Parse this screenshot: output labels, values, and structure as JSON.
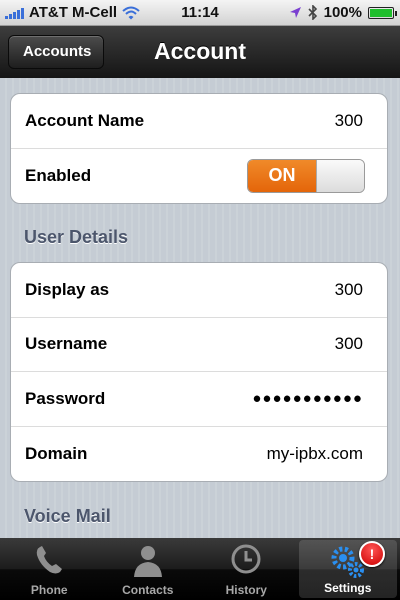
{
  "status_bar": {
    "carrier": "AT&T M-Cell",
    "time": "11:14",
    "battery": "100%",
    "battery_level": 1.0
  },
  "nav": {
    "back_label": "Accounts",
    "title": "Account"
  },
  "account_group": {
    "rows": [
      {
        "label": "Account Name",
        "value": "300"
      },
      {
        "label": "Enabled",
        "toggle": "ON"
      }
    ]
  },
  "user_details": {
    "header": "User Details",
    "rows": [
      {
        "label": "Display as",
        "value": "300"
      },
      {
        "label": "Username",
        "value": "300"
      },
      {
        "label": "Password",
        "value": "●●●●●●●●●●●"
      },
      {
        "label": "Domain",
        "value": "my-ipbx.com"
      }
    ]
  },
  "voice_mail": {
    "header": "Voice Mail"
  },
  "tabs": [
    {
      "label": "Phone",
      "icon": "phone-icon"
    },
    {
      "label": "Contacts",
      "icon": "contacts-icon"
    },
    {
      "label": "History",
      "icon": "clock-icon"
    },
    {
      "label": "Settings",
      "icon": "gears-icon",
      "active": true,
      "badge": "!"
    }
  ],
  "colors": {
    "toggle_on": "#e97014",
    "section_header": "#4c566c",
    "badge": "#d40000"
  }
}
